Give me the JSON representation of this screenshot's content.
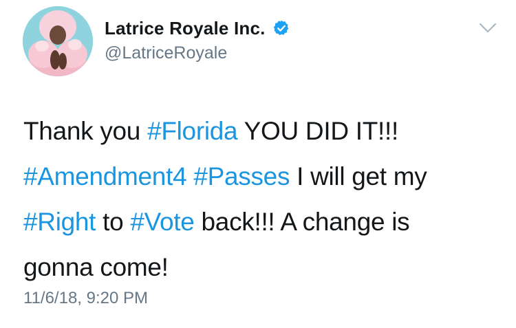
{
  "user": {
    "display_name": "Latrice Royale Inc.",
    "handle": "@LatriceRoyale",
    "verified": true,
    "avatar_icon": "profile-photo"
  },
  "icons": {
    "verified": "verified-badge-icon",
    "menu": "chevron-down-icon"
  },
  "tweet": {
    "lines": [
      [
        {
          "text": "Thank you ",
          "type": "text"
        },
        {
          "text": "#Florida",
          "type": "hashtag"
        },
        {
          "text": " YOU DID IT!!!",
          "type": "text"
        }
      ],
      [
        {
          "text": "#Amendment4",
          "type": "hashtag"
        },
        {
          "text": " ",
          "type": "text"
        },
        {
          "text": "#Passes",
          "type": "hashtag"
        },
        {
          "text": " I will get my",
          "type": "text"
        }
      ],
      [
        {
          "text": "#Right",
          "type": "hashtag"
        },
        {
          "text": " to ",
          "type": "text"
        },
        {
          "text": "#Vote",
          "type": "hashtag"
        },
        {
          "text": " back!!!  A change is",
          "type": "text"
        }
      ],
      [
        {
          "text": "gonna come!",
          "type": "text"
        }
      ]
    ],
    "timestamp": "11/6/18, 9:20 PM"
  },
  "colors": {
    "hashtag": "#1b95e0",
    "verified": "#1da1f2",
    "secondary_text": "#657786",
    "primary_text": "#14171a"
  }
}
